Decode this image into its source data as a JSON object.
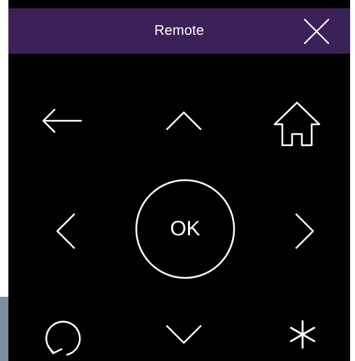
{
  "header": {
    "title": "Remote",
    "background_color": "#3c2159",
    "close_icon": "close-icon"
  },
  "remote": {
    "background_color": "#000000",
    "foreground_color": "#ffffff",
    "buttons": [
      {
        "name": "back",
        "icon": "back-arrow-icon"
      },
      {
        "name": "up",
        "icon": "chevron-up-icon"
      },
      {
        "name": "home",
        "icon": "home-icon"
      },
      {
        "name": "left",
        "icon": "chevron-left-icon"
      },
      {
        "name": "ok",
        "label": "OK"
      },
      {
        "name": "right",
        "icon": "chevron-right-icon"
      },
      {
        "name": "replay",
        "icon": "replay-icon"
      },
      {
        "name": "down",
        "icon": "chevron-down-icon"
      },
      {
        "name": "options",
        "icon": "asterisk-icon"
      }
    ]
  }
}
